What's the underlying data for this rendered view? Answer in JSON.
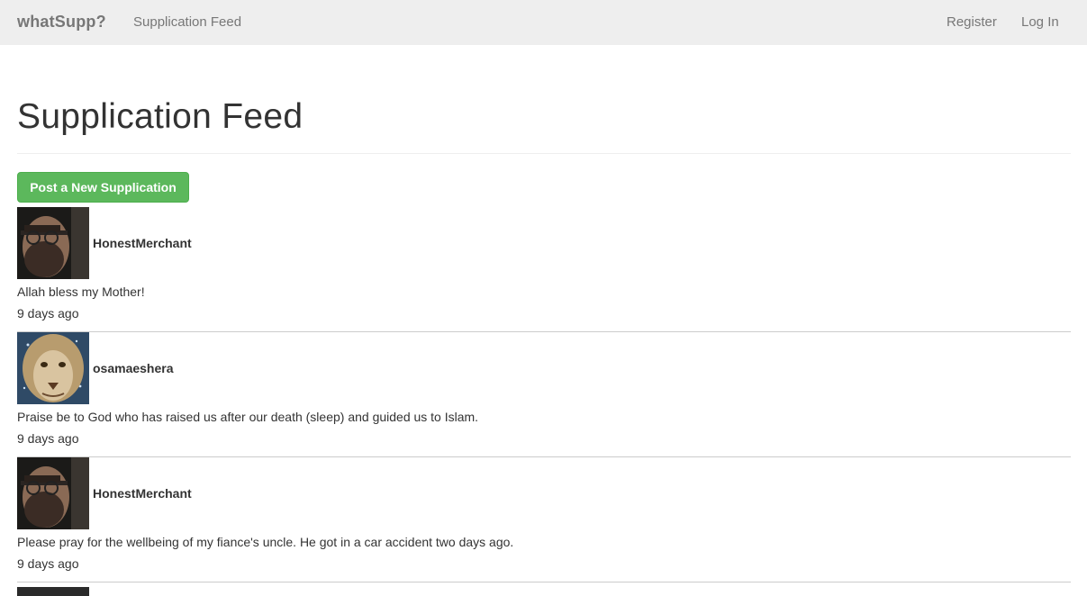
{
  "navbar": {
    "brand": "whatSupp?",
    "links": {
      "feed": "Supplication Feed",
      "register": "Register",
      "login": "Log In"
    }
  },
  "page": {
    "title": "Supplication Feed",
    "post_button": "Post a New Supplication"
  },
  "posts": [
    {
      "username": "HonestMerchant",
      "avatar": "man-with-glasses-avatar",
      "text": "Allah bless my Mother!",
      "time": "9 days ago"
    },
    {
      "username": "osamaeshera",
      "avatar": "lion-avatar",
      "text": "Praise be to God who has raised us after our death (sleep) and guided us to Islam.",
      "time": "9 days ago"
    },
    {
      "username": "HonestMerchant",
      "avatar": "man-with-glasses-avatar",
      "text": "Please pray for the wellbeing of my fiance's uncle. He got in a car accident two days ago.",
      "time": "9 days ago"
    }
  ],
  "colors": {
    "navbar_bg": "#eeeeee",
    "nav_text": "#777777",
    "button_green": "#5cb85c",
    "text": "#333333"
  }
}
